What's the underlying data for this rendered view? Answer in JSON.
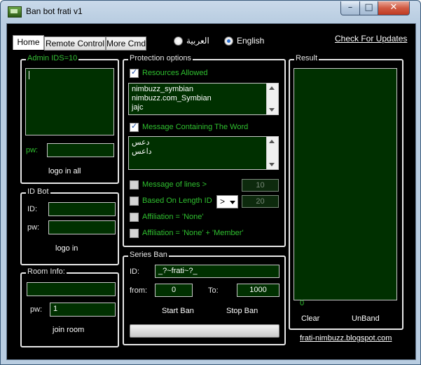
{
  "window": {
    "title": "Ban bot frati v1"
  },
  "tabs": [
    {
      "label": "Home",
      "active": true
    },
    {
      "label": "Remote Control",
      "active": false
    },
    {
      "label": "More Cmd",
      "active": false
    }
  ],
  "language": {
    "arabic": "العربية",
    "english": "English",
    "selected": "English"
  },
  "check_updates": "Check For Updates",
  "admin": {
    "title": "Admin IDS=10",
    "ids_value": "",
    "pw_label": "pw:",
    "pw_value": "",
    "login_label": "logo in all"
  },
  "id_bot": {
    "title": "ID Bot",
    "id_label": "ID:",
    "pw_label": "pw:",
    "login_label": "logo in"
  },
  "room": {
    "title": "Room Info:",
    "pw_label": "pw:",
    "pw_value": "1",
    "join_label": "join room"
  },
  "protection": {
    "title": "Protection options",
    "resources_label": "Resources Allowed",
    "resources_checked": true,
    "resources": [
      "nimbuzz_symbian",
      "nimbuzz.com_Symbian",
      "jajc"
    ],
    "message_word_label": "Message Containing The Word",
    "message_word_checked": true,
    "words": [
      "دعس",
      "داعس"
    ],
    "lines_label": "Message of lines >",
    "lines_value": "10",
    "length_label": "Based On Length ID",
    "length_op": ">",
    "length_value": "20",
    "aff_none_label": "Affiliation = 'None'",
    "aff_member_label": "Affiliation = 'None' + 'Member'"
  },
  "series": {
    "title": "Series Ban",
    "id_label": "ID:",
    "id_value": "_?~frati~?_",
    "from_label": "from:",
    "from_value": "0",
    "to_label": "To:",
    "to_value": "1000",
    "start_label": "Start Ban",
    "stop_label": "Stop Ban",
    "progress": 0
  },
  "result": {
    "title": "Result",
    "count": "0",
    "clear_label": "Clear",
    "unband_label": "UnBand"
  },
  "footer_link": "frati-nimbuzz.blogspot.com"
}
